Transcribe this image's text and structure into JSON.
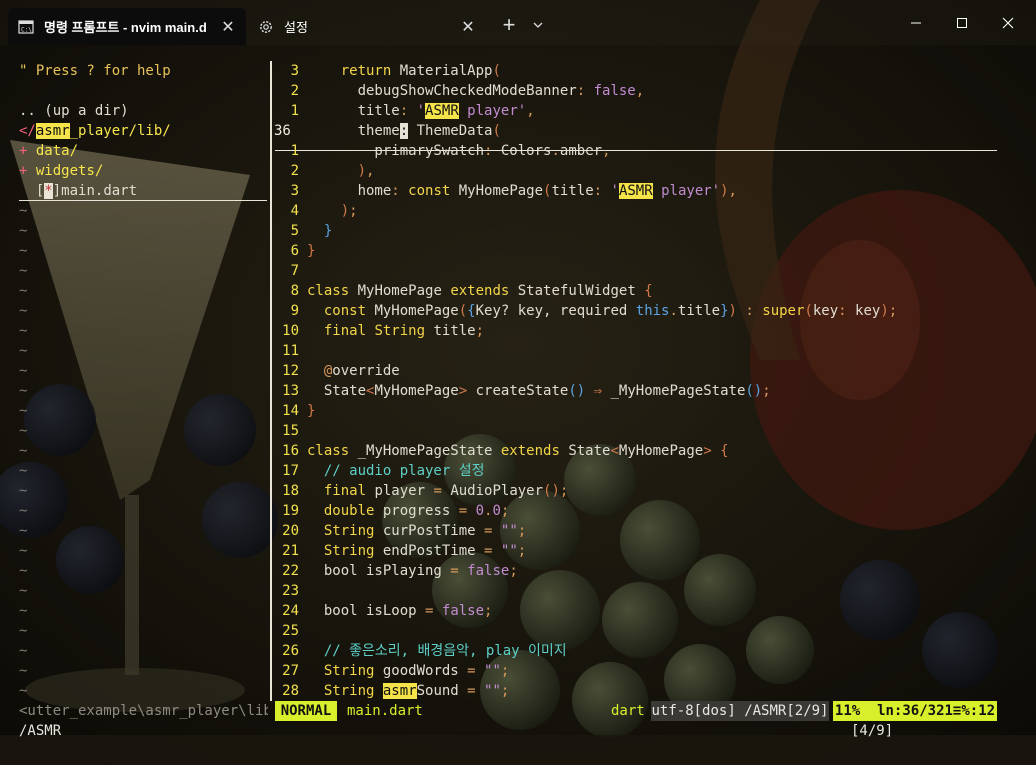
{
  "window": {
    "tabs": [
      {
        "label": "명령 프롬프트 - nvim  main.d",
        "icon": "cmd-icon",
        "active": true
      },
      {
        "label": "설정",
        "icon": "gear-icon",
        "active": false
      }
    ],
    "new_tab_glyph": "+",
    "dropdown_glyph": "⌄",
    "close_glyph": "✕",
    "controls": {
      "minimize": "minimize-icon",
      "maximize": "maximize-icon",
      "close": "close-icon"
    }
  },
  "file_tree": {
    "help": "\" Press ? for help",
    "up_dir": ".. (up a dir)",
    "root_prefix": "</",
    "root_hl": "asmr",
    "root_rest": "_player/lib/",
    "entries": [
      {
        "marker": "+",
        "name": "data/"
      },
      {
        "marker": "+",
        "name": "widgets/"
      }
    ],
    "current_file": {
      "bracket": "[",
      "marker": "*",
      "close": "]",
      "name": "main.dart"
    },
    "tilde": "~"
  },
  "editor": {
    "lines": [
      {
        "n": "3",
        "parts": [
          [
            "",
            "    "
          ],
          [
            "kw",
            "return"
          ],
          [
            "",
            " MaterialApp"
          ],
          [
            "brk",
            "("
          ]
        ]
      },
      {
        "n": "2",
        "parts": [
          [
            "",
            "      debugShowCheckedModeBanner"
          ],
          [
            "pun",
            ":"
          ],
          [
            "",
            " "
          ],
          [
            "bool",
            "false"
          ],
          [
            "pun",
            ","
          ]
        ]
      },
      {
        "n": "1",
        "parts": [
          [
            "",
            "      title"
          ],
          [
            "pun",
            ":"
          ],
          [
            "",
            " "
          ],
          [
            "str",
            "'"
          ],
          [
            "hl",
            "ASMR"
          ],
          [
            "str",
            " player'"
          ],
          [
            "pun",
            ","
          ]
        ]
      },
      {
        "n": "36",
        "current": true,
        "parts": [
          [
            "",
            "      theme"
          ],
          [
            "cur",
            ":"
          ],
          [
            "",
            " ThemeData"
          ],
          [
            "brk",
            "("
          ]
        ]
      },
      {
        "n": "1",
        "parts": [
          [
            "",
            "        primarySwatch"
          ],
          [
            "pun",
            ":"
          ],
          [
            "",
            " Colors"
          ],
          [
            "pun",
            "."
          ],
          [
            "",
            "amber"
          ],
          [
            "pun",
            ","
          ]
        ]
      },
      {
        "n": "2",
        "parts": [
          [
            "",
            "      "
          ],
          [
            "brk",
            ")"
          ],
          [
            "pun",
            ","
          ]
        ]
      },
      {
        "n": "3",
        "parts": [
          [
            "",
            "      home"
          ],
          [
            "pun",
            ":"
          ],
          [
            "",
            " "
          ],
          [
            "kw",
            "const"
          ],
          [
            "",
            " MyHomePage"
          ],
          [
            "brk",
            "("
          ],
          [
            "",
            "title"
          ],
          [
            "pun",
            ":"
          ],
          [
            "",
            " "
          ],
          [
            "str",
            "'"
          ],
          [
            "hl",
            "ASMR"
          ],
          [
            "str",
            " player'"
          ],
          [
            "brk",
            ")"
          ],
          [
            "pun",
            ","
          ]
        ]
      },
      {
        "n": "4",
        "parts": [
          [
            "",
            "    "
          ],
          [
            "brk",
            ")"
          ],
          [
            "pun",
            ";"
          ]
        ]
      },
      {
        "n": "5",
        "parts": [
          [
            "",
            "  "
          ],
          [
            "brk2",
            "}"
          ]
        ]
      },
      {
        "n": "6",
        "parts": [
          [
            "brk",
            "}"
          ]
        ]
      },
      {
        "n": "7",
        "parts": []
      },
      {
        "n": "8",
        "parts": [
          [
            "kw",
            "class"
          ],
          [
            "",
            " MyHomePage "
          ],
          [
            "kw",
            "extends"
          ],
          [
            "",
            " StatefulWidget "
          ],
          [
            "brk",
            "{"
          ]
        ]
      },
      {
        "n": "9",
        "parts": [
          [
            "",
            "  "
          ],
          [
            "kw",
            "const"
          ],
          [
            "",
            " MyHomePage"
          ],
          [
            "brk",
            "("
          ],
          [
            "brk2",
            "{"
          ],
          [
            "",
            "Key? key, required "
          ],
          [
            "brk2",
            "this"
          ],
          [
            "pun",
            "."
          ],
          [
            "",
            "title"
          ],
          [
            "brk2",
            "}"
          ],
          [
            "brk",
            ")"
          ],
          [
            "",
            " "
          ],
          [
            "pun",
            ":"
          ],
          [
            "",
            " "
          ],
          [
            "kw",
            "super"
          ],
          [
            "brk",
            "("
          ],
          [
            "",
            "key"
          ],
          [
            "pun",
            ":"
          ],
          [
            "",
            " key"
          ],
          [
            "brk",
            ")"
          ],
          [
            "pun",
            ";"
          ]
        ]
      },
      {
        "n": "10",
        "parts": [
          [
            "",
            "  "
          ],
          [
            "kw",
            "final"
          ],
          [
            "",
            " "
          ],
          [
            "kw",
            "String"
          ],
          [
            "",
            " title"
          ],
          [
            "pun",
            ";"
          ]
        ]
      },
      {
        "n": "11",
        "parts": []
      },
      {
        "n": "12",
        "parts": [
          [
            "",
            "  "
          ],
          [
            "pun",
            "@"
          ],
          [
            "",
            "override"
          ]
        ]
      },
      {
        "n": "13",
        "parts": [
          [
            "",
            "  State"
          ],
          [
            "brk",
            "<"
          ],
          [
            "",
            "MyHomePage"
          ],
          [
            "brk",
            ">"
          ],
          [
            "",
            " createState"
          ],
          [
            "brk2",
            "()"
          ],
          [
            "",
            " "
          ],
          [
            "brk",
            "⇒"
          ],
          [
            "",
            " _MyHomePageState"
          ],
          [
            "brk2",
            "()"
          ],
          [
            "pun",
            ";"
          ]
        ]
      },
      {
        "n": "14",
        "parts": [
          [
            "brk",
            "}"
          ]
        ]
      },
      {
        "n": "15",
        "parts": []
      },
      {
        "n": "16",
        "parts": [
          [
            "kw",
            "class"
          ],
          [
            "",
            " _MyHomePageState "
          ],
          [
            "kw",
            "extends"
          ],
          [
            "",
            " State"
          ],
          [
            "brk",
            "<"
          ],
          [
            "",
            "MyHomePage"
          ],
          [
            "brk",
            ">"
          ],
          [
            "",
            " "
          ],
          [
            "brk",
            "{"
          ]
        ]
      },
      {
        "n": "17",
        "parts": [
          [
            "",
            "  "
          ],
          [
            "cm",
            "// audio player 설정"
          ]
        ]
      },
      {
        "n": "18",
        "parts": [
          [
            "",
            "  "
          ],
          [
            "kw",
            "final"
          ],
          [
            "",
            " player "
          ],
          [
            "pun",
            "="
          ],
          [
            "",
            " AudioPlayer"
          ],
          [
            "brk",
            "()"
          ],
          [
            "pun",
            ";"
          ]
        ]
      },
      {
        "n": "19",
        "parts": [
          [
            "",
            "  "
          ],
          [
            "kw",
            "double"
          ],
          [
            "",
            " progress "
          ],
          [
            "pun",
            "="
          ],
          [
            "",
            " "
          ],
          [
            "num",
            "0"
          ],
          [
            "pun",
            "."
          ],
          [
            "num",
            "0"
          ],
          [
            "pun",
            ";"
          ]
        ]
      },
      {
        "n": "20",
        "parts": [
          [
            "",
            "  "
          ],
          [
            "kw",
            "String"
          ],
          [
            "",
            " curPostTime "
          ],
          [
            "pun",
            "="
          ],
          [
            "",
            " "
          ],
          [
            "str",
            "\"\""
          ],
          [
            "pun",
            ";"
          ]
        ]
      },
      {
        "n": "21",
        "parts": [
          [
            "",
            "  "
          ],
          [
            "kw",
            "String"
          ],
          [
            "",
            " endPostTime "
          ],
          [
            "pun",
            "="
          ],
          [
            "",
            " "
          ],
          [
            "str",
            "\"\""
          ],
          [
            "pun",
            ";"
          ]
        ]
      },
      {
        "n": "22",
        "parts": [
          [
            "",
            "  bool isPlaying "
          ],
          [
            "pun",
            "="
          ],
          [
            "",
            " "
          ],
          [
            "bool",
            "false"
          ],
          [
            "pun",
            ";"
          ]
        ]
      },
      {
        "n": "23",
        "parts": []
      },
      {
        "n": "24",
        "parts": [
          [
            "",
            "  bool isLoop "
          ],
          [
            "pun",
            "="
          ],
          [
            "",
            " "
          ],
          [
            "bool",
            "false"
          ],
          [
            "pun",
            ";"
          ]
        ]
      },
      {
        "n": "25",
        "parts": []
      },
      {
        "n": "26",
        "parts": [
          [
            "",
            "  "
          ],
          [
            "cm",
            "// 좋은소리, 배경음악, play 이미지"
          ]
        ]
      },
      {
        "n": "27",
        "parts": [
          [
            "",
            "  "
          ],
          [
            "kw",
            "String"
          ],
          [
            "",
            " goodWords "
          ],
          [
            "pun",
            "="
          ],
          [
            "",
            " "
          ],
          [
            "str",
            "\"\""
          ],
          [
            "pun",
            ";"
          ]
        ]
      },
      {
        "n": "28",
        "parts": [
          [
            "",
            "  "
          ],
          [
            "kw",
            "String"
          ],
          [
            "",
            " "
          ],
          [
            "hl",
            "asmr"
          ],
          [
            "",
            "Sound "
          ],
          [
            "pun",
            "="
          ],
          [
            "",
            " "
          ],
          [
            "str",
            "\"\""
          ],
          [
            "pun",
            ";"
          ]
        ]
      }
    ]
  },
  "statusline": {
    "tree_path": "<utter_example\\asmr_player\\lib",
    "mode": "NORMAL",
    "filename": "main.dart",
    "filetype": "dart",
    "encoding": "utf-8[dos] /ASMR[2/9]",
    "position": "11%  ln:36/321≡%:12"
  },
  "cmdline": {
    "text": "/ASMR",
    "count": "[4/9]"
  },
  "colors": {
    "line_number": "#f2e14c",
    "mode_bg": "#d8ef2c",
    "search_highlight": "#f5e34a",
    "tab_active_bg": "#0c0c0c"
  }
}
